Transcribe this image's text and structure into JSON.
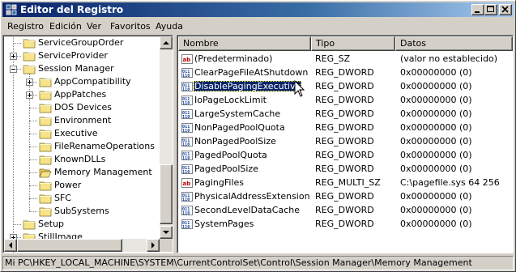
{
  "window": {
    "title": "Editor del Registro",
    "title_icon": "regedit-icon"
  },
  "menu": {
    "items": [
      {
        "label": "Registro"
      },
      {
        "label": "Edición"
      },
      {
        "label": "Ver"
      },
      {
        "label": "Favoritos"
      },
      {
        "label": "Ayuda"
      }
    ]
  },
  "tree": {
    "nodes": [
      {
        "label": "ServiceGroupOrder",
        "depth": 0,
        "expander": "none"
      },
      {
        "label": "ServiceProvider",
        "depth": 0,
        "expander": "plus"
      },
      {
        "label": "Session Manager",
        "depth": 0,
        "expander": "minus"
      },
      {
        "label": "AppCompatibility",
        "depth": 1,
        "expander": "plus"
      },
      {
        "label": "AppPatches",
        "depth": 1,
        "expander": "plus"
      },
      {
        "label": "DOS Devices",
        "depth": 1,
        "expander": "none"
      },
      {
        "label": "Environment",
        "depth": 1,
        "expander": "none"
      },
      {
        "label": "Executive",
        "depth": 1,
        "expander": "none"
      },
      {
        "label": "FileRenameOperations",
        "depth": 1,
        "expander": "none"
      },
      {
        "label": "KnownDLLs",
        "depth": 1,
        "expander": "none"
      },
      {
        "label": "Memory Management",
        "depth": 1,
        "expander": "none",
        "open": true
      },
      {
        "label": "Power",
        "depth": 1,
        "expander": "none"
      },
      {
        "label": "SFC",
        "depth": 1,
        "expander": "none"
      },
      {
        "label": "SubSystems",
        "depth": 1,
        "expander": "none"
      },
      {
        "label": "Setup",
        "depth": 0,
        "expander": "none"
      },
      {
        "label": "StillImage",
        "depth": 0,
        "expander": "plus"
      }
    ]
  },
  "list": {
    "columns": [
      {
        "label": "Nombre"
      },
      {
        "label": "Tipo"
      },
      {
        "label": "Datos"
      }
    ],
    "rows": [
      {
        "name": "(Predeterminado)",
        "type": "REG_SZ",
        "data": "(valor no establecido)",
        "icon": "string-value-icon"
      },
      {
        "name": "ClearPageFileAtShutdown",
        "type": "REG_DWORD",
        "data": "0x00000000 (0)",
        "icon": "binary-value-icon"
      },
      {
        "name": "DisablePagingExecutive",
        "type": "REG_DWORD",
        "data": "0x00000000 (0)",
        "icon": "binary-value-icon",
        "selected": true
      },
      {
        "name": "IoPageLockLimit",
        "type": "REG_DWORD",
        "data": "0x00000000 (0)",
        "icon": "binary-value-icon"
      },
      {
        "name": "LargeSystemCache",
        "type": "REG_DWORD",
        "data": "0x00000000 (0)",
        "icon": "binary-value-icon"
      },
      {
        "name": "NonPagedPoolQuota",
        "type": "REG_DWORD",
        "data": "0x00000000 (0)",
        "icon": "binary-value-icon"
      },
      {
        "name": "NonPagedPoolSize",
        "type": "REG_DWORD",
        "data": "0x00000000 (0)",
        "icon": "binary-value-icon"
      },
      {
        "name": "PagedPoolQuota",
        "type": "REG_DWORD",
        "data": "0x00000000 (0)",
        "icon": "binary-value-icon"
      },
      {
        "name": "PagedPoolSize",
        "type": "REG_DWORD",
        "data": "0x00000000 (0)",
        "icon": "binary-value-icon"
      },
      {
        "name": "PagingFiles",
        "type": "REG_MULTI_SZ",
        "data": "C:\\pagefile.sys 64 256",
        "icon": "string-value-icon"
      },
      {
        "name": "PhysicalAddressExtension",
        "type": "REG_DWORD",
        "data": "0x00000000 (0)",
        "icon": "binary-value-icon"
      },
      {
        "name": "SecondLevelDataCache",
        "type": "REG_DWORD",
        "data": "0x00000000 (0)",
        "icon": "binary-value-icon"
      },
      {
        "name": "SystemPages",
        "type": "REG_DWORD",
        "data": "0x00000000 (0)",
        "icon": "binary-value-icon"
      }
    ]
  },
  "status": {
    "path": "Mi PC\\HKEY_LOCAL_MACHINE\\SYSTEM\\CurrentControlSet\\Control\\Session Manager\\Memory Management"
  },
  "colors": {
    "titlebar_start": "#0a246a",
    "titlebar_end": "#a6caf0",
    "selection": "#0a246a",
    "face": "#d4d0c8"
  }
}
